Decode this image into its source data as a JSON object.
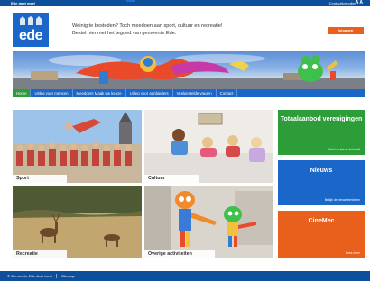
{
  "topbar": {
    "site_label": "Ede doet mee!",
    "contact": "Contactformulier",
    "text_size": "A A"
  },
  "logo": {
    "text": "ede"
  },
  "intro": {
    "text": "Weinig te besteden? Toch meedoen aan sport, cultuur en recreatie! Bestel hier met het tegoed van gemeente Ede.",
    "button": "Inloggen"
  },
  "nav": {
    "items": [
      "Home",
      "Uitleg voor mensen",
      "Meedoen! Maak uw keuze",
      "Uitleg voor aanbieders",
      "Veelgestelde vragen",
      "Contact"
    ],
    "active_index": 0
  },
  "tiles": {
    "sport": "Sport",
    "cultuur": "Cultuur",
    "recreatie": "Recreatie",
    "overige": "Overige activiteiten"
  },
  "sidebar": {
    "totaal": {
      "title": "Totaalaanbod verenigingen",
      "more": "Vind uw keuze inclusief"
    },
    "nieuws": {
      "title": "Nieuws",
      "more": "Bekijk de nieuwsberichten"
    },
    "cinemec": {
      "title": "CineMec",
      "more": "Lees meer"
    }
  },
  "footer": {
    "copyright": "© Gemeente Ede doet mee!",
    "sitemap": "Sitemap"
  },
  "colors": {
    "blue": "#1b66c9",
    "green": "#2d9d3a",
    "orange": "#e8601c",
    "dark_blue": "#0e4f9c"
  }
}
